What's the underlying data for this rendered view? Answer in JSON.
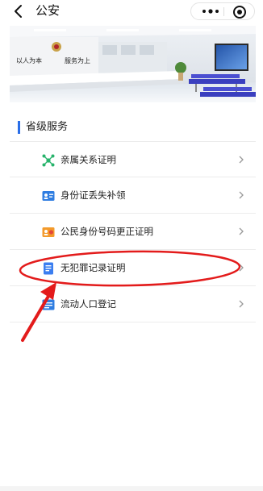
{
  "header": {
    "title": "公安",
    "back_icon": "chevron-left-icon",
    "more_icon": "more-dots-icon",
    "close_icon": "target-circle-icon"
  },
  "banner": {
    "slogan_left": "以人为本",
    "slogan_right": "服务为上",
    "image": "service-hall-photo"
  },
  "section": {
    "title": "省级服务"
  },
  "services": [
    {
      "label": "亲属关系证明",
      "icon": "network-nodes-icon",
      "icon_color": "#27b36b"
    },
    {
      "label": "身份证丢失补领",
      "icon": "id-card-icon",
      "icon_color": "#2f7de1"
    },
    {
      "label": "公民身份号码更正证明",
      "icon": "certificate-icon",
      "icon_color": "#f39a2b"
    },
    {
      "label": "无犯罪记录证明",
      "icon": "document-icon",
      "icon_color": "#3b7ef0"
    },
    {
      "label": "流动人口登记",
      "icon": "registration-icon",
      "icon_color": "#2f7de1"
    }
  ],
  "colors": {
    "accent": "#2a6ee8",
    "annotation_red": "#e31b1b"
  }
}
